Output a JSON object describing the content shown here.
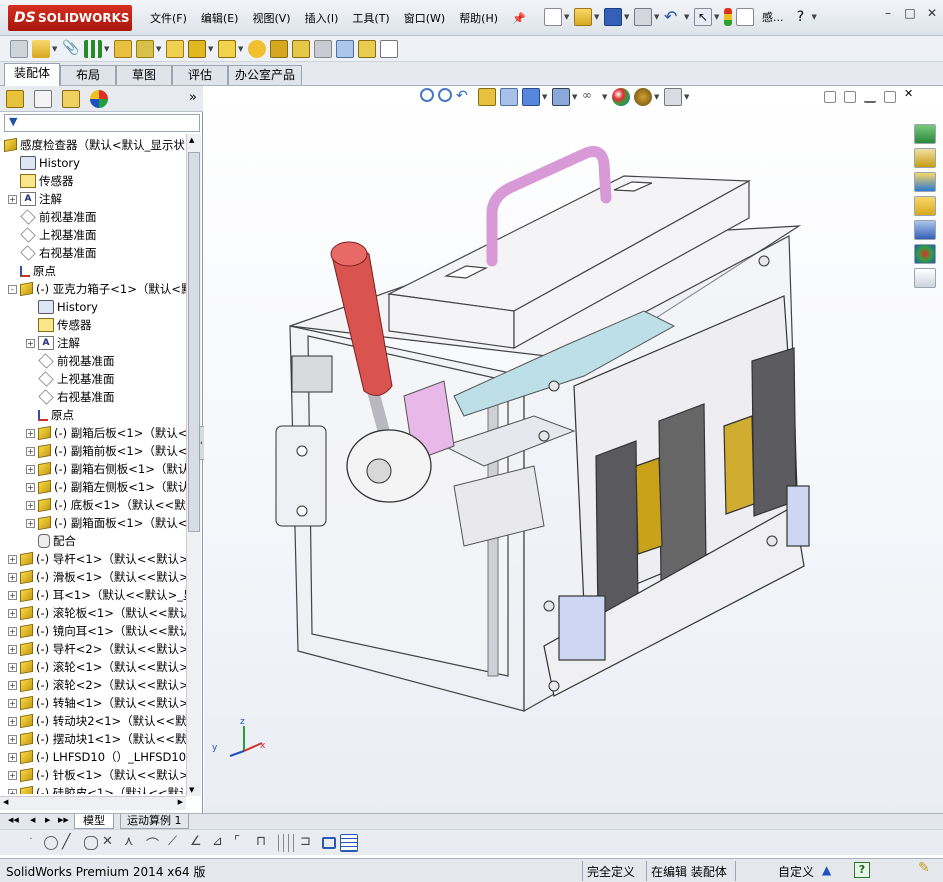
{
  "app": {
    "logo_prefix": "DS",
    "logo_text": "SOLIDWORKS"
  },
  "menu": [
    "文件(F)",
    "编辑(E)",
    "视图(V)",
    "插入(I)",
    "工具(T)",
    "窗口(W)",
    "帮助(H)"
  ],
  "title_search": "感...",
  "command_tabs": [
    "装配体",
    "布局",
    "草图",
    "评估",
    "办公室产品"
  ],
  "tree": {
    "root": "感度检查器（默认<默认_显示状",
    "items": [
      {
        "label": "History",
        "icon": "history-icon",
        "level": 1,
        "expand": ""
      },
      {
        "label": "传感器",
        "icon": "sensor-icon",
        "level": 1,
        "expand": ""
      },
      {
        "label": "注解",
        "icon": "annotation-icon",
        "level": 1,
        "expand": "+"
      },
      {
        "label": "前视基准面",
        "icon": "plane-icon",
        "level": 1,
        "expand": ""
      },
      {
        "label": "上视基准面",
        "icon": "plane-icon",
        "level": 1,
        "expand": ""
      },
      {
        "label": "右视基准面",
        "icon": "plane-icon",
        "level": 1,
        "expand": ""
      },
      {
        "label": "原点",
        "icon": "origin-icon",
        "level": 1,
        "expand": ""
      },
      {
        "label": "(-) 亚克力箱子<1>（默认<默",
        "icon": "part-icon",
        "level": 1,
        "expand": "-"
      },
      {
        "label": "History",
        "icon": "history-icon",
        "level": 2,
        "expand": ""
      },
      {
        "label": "传感器",
        "icon": "sensor-icon",
        "level": 2,
        "expand": ""
      },
      {
        "label": "注解",
        "icon": "annotation-icon",
        "level": 2,
        "expand": "+"
      },
      {
        "label": "前视基准面",
        "icon": "plane-icon",
        "level": 2,
        "expand": ""
      },
      {
        "label": "上视基准面",
        "icon": "plane-icon",
        "level": 2,
        "expand": ""
      },
      {
        "label": "右视基准面",
        "icon": "plane-icon",
        "level": 2,
        "expand": ""
      },
      {
        "label": "原点",
        "icon": "origin-icon",
        "level": 2,
        "expand": ""
      },
      {
        "label": "(-) 副箱后板<1>（默认<",
        "icon": "part-icon",
        "level": 2,
        "expand": "+"
      },
      {
        "label": "(-) 副箱前板<1>（默认<",
        "icon": "part-icon",
        "level": 2,
        "expand": "+"
      },
      {
        "label": "(-) 副箱右侧板<1>（默认",
        "icon": "part-icon",
        "level": 2,
        "expand": "+"
      },
      {
        "label": "(-) 副箱左侧板<1>（默认",
        "icon": "part-icon",
        "level": 2,
        "expand": "+"
      },
      {
        "label": "(-) 底板<1>（默认<<默认",
        "icon": "part-icon",
        "level": 2,
        "expand": "+"
      },
      {
        "label": "(-) 副箱面板<1>（默认<",
        "icon": "part-icon",
        "level": 2,
        "expand": "+"
      },
      {
        "label": "配合",
        "icon": "mate-icon",
        "level": 2,
        "expand": ""
      },
      {
        "label": "(-) 导杆<1>（默认<<默认>_",
        "icon": "part-icon",
        "level": 1,
        "expand": "+"
      },
      {
        "label": "(-) 滑板<1>（默认<<默认>_",
        "icon": "part-icon",
        "level": 1,
        "expand": "+"
      },
      {
        "label": "(-) 耳<1>（默认<<默认>_显",
        "icon": "part-icon",
        "level": 1,
        "expand": "+"
      },
      {
        "label": "(-) 滚轮板<1>（默认<<默认",
        "icon": "part-icon",
        "level": 1,
        "expand": "+"
      },
      {
        "label": "(-) 镜向耳<1>（默认<<默认",
        "icon": "part-icon",
        "level": 1,
        "expand": "+"
      },
      {
        "label": "(-) 导杆<2>（默认<<默认>_",
        "icon": "part-icon",
        "level": 1,
        "expand": "+"
      },
      {
        "label": "(-) 滚轮<1>（默认<<默认>_",
        "icon": "part-icon",
        "level": 1,
        "expand": "+"
      },
      {
        "label": "(-) 滚轮<2>（默认<<默认>_",
        "icon": "part-icon",
        "level": 1,
        "expand": "+"
      },
      {
        "label": "(-) 转轴<1>（默认<<默认>_",
        "icon": "part-icon",
        "level": 1,
        "expand": "+"
      },
      {
        "label": "(-) 转动块2<1>（默认<<默认",
        "icon": "part-icon",
        "level": 1,
        "expand": "+"
      },
      {
        "label": "(-) 摆动块1<1>（默认<<默认",
        "icon": "part-icon",
        "level": 1,
        "expand": "+"
      },
      {
        "label": "(-) LHFSD10（）_LHFSD10<1",
        "icon": "part-icon",
        "level": 1,
        "expand": "+"
      },
      {
        "label": "(-) 针板<1>（默认<<默认>_",
        "icon": "part-icon",
        "level": 1,
        "expand": "+"
      },
      {
        "label": "(-) 硅胶皮<1>（默认<<默认>",
        "icon": "part-icon",
        "level": 1,
        "expand": "+"
      }
    ]
  },
  "bottom_tabs": [
    "模型",
    "运动算例 1"
  ],
  "status": {
    "product": "SolidWorks Premium 2014 x64 版",
    "state": "完全定义",
    "mode": "在编辑 装配体",
    "units": "自定义",
    "help": "?"
  },
  "triad": {
    "x": "x",
    "y": "y",
    "z": "z"
  },
  "colors": {
    "handle_red": "#d9534f",
    "handle_pink": "#e0a8dc",
    "brass": "#c9a21a",
    "frame": "#f2f2f4"
  }
}
